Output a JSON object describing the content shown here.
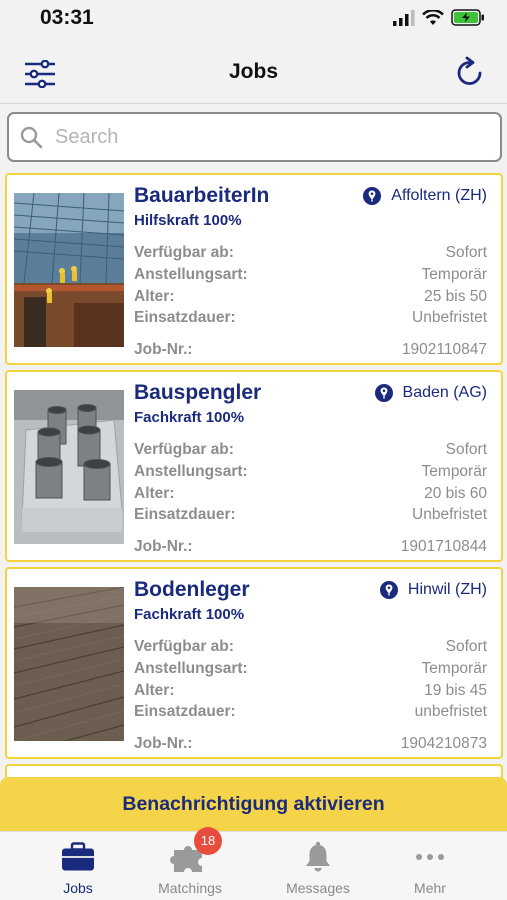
{
  "status_bar": {
    "time": "03:31"
  },
  "header": {
    "title": "Jobs",
    "filter_icon": "sliders-icon",
    "refresh_icon": "refresh-icon"
  },
  "search": {
    "placeholder": "Search",
    "value": ""
  },
  "jobs": [
    {
      "title": "BauarbeiterIn",
      "subtitle": "Hilfskraft 100%",
      "location": "Affoltern (ZH)",
      "fields": [
        {
          "label": "Verfügbar ab:",
          "value": "Sofort"
        },
        {
          "label": "Anstellungsart:",
          "value": "Temporär"
        },
        {
          "label": "Alter:",
          "value": "25 bis 50"
        },
        {
          "label": "Einsatzdauer:",
          "value": "Unbefristet"
        }
      ],
      "job_nr_label": "Job-Nr.:",
      "job_nr": "1902110847"
    },
    {
      "title": "Bauspengler",
      "subtitle": "Fachkraft 100%",
      "location": "Baden (AG)",
      "fields": [
        {
          "label": "Verfügbar ab:",
          "value": "Sofort"
        },
        {
          "label": "Anstellungsart:",
          "value": "Temporär"
        },
        {
          "label": "Alter:",
          "value": "20 bis 60"
        },
        {
          "label": "Einsatzdauer:",
          "value": "Unbefristet"
        }
      ],
      "job_nr_label": "Job-Nr.:",
      "job_nr": "1901710844"
    },
    {
      "title": "Bodenleger",
      "subtitle": "Fachkraft 100%",
      "location": "Hinwil (ZH)",
      "fields": [
        {
          "label": "Verfügbar ab:",
          "value": "Sofort"
        },
        {
          "label": "Anstellungsart:",
          "value": "Temporär"
        },
        {
          "label": "Alter:",
          "value": "19 bis 45"
        },
        {
          "label": "Einsatzdauer:",
          "value": "unbefristet"
        }
      ],
      "job_nr_label": "Job-Nr.:",
      "job_nr": "1904210873"
    }
  ],
  "banner": {
    "label": "Benachrichtigung aktivieren"
  },
  "tabs": [
    {
      "label": "Jobs",
      "icon": "briefcase-icon",
      "active": true
    },
    {
      "label": "Matchings",
      "icon": "puzzle-icon",
      "badge": "18"
    },
    {
      "label": "Messages",
      "icon": "bell-icon"
    },
    {
      "label": "Mehr",
      "icon": "more-icon"
    }
  ],
  "colors": {
    "brand": "#1a2a7c",
    "accent": "#f6d44a",
    "badge": "#e74c3c"
  }
}
